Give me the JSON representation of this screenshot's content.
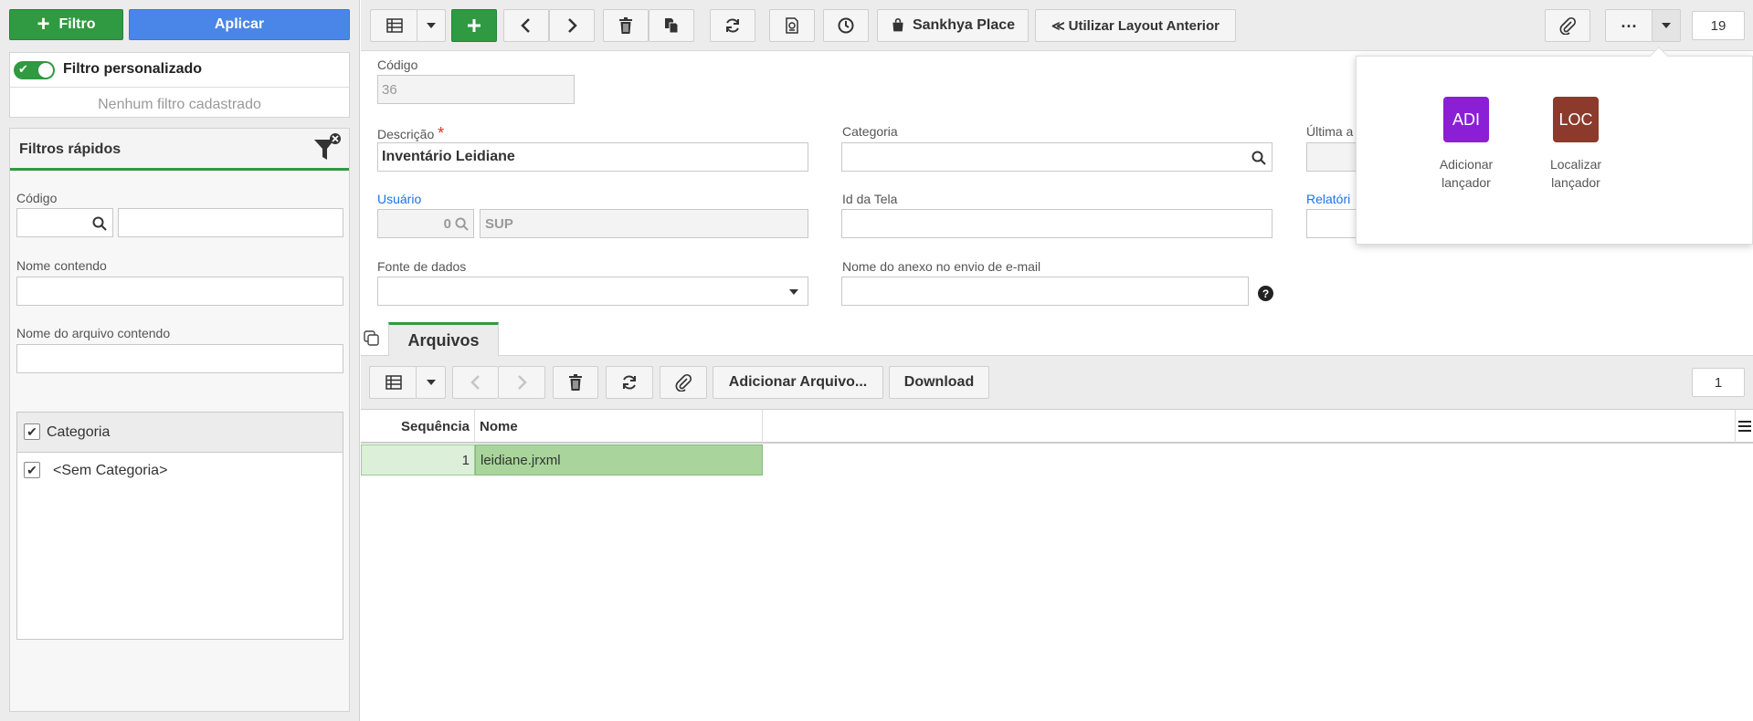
{
  "left": {
    "filter_button": "Filtro",
    "apply_button": "Aplicar",
    "custom_filter_label": "Filtro personalizado",
    "no_filter_text": "Nenhum filtro cadastrado",
    "quick_filters_title": "Filtros rápidos",
    "codigo_label": "Código",
    "nome_contendo_label": "Nome contendo",
    "arquivo_contendo_label": "Nome do arquivo contendo",
    "categoria_header": "Categoria",
    "categoria_item": "<Sem Categoria>"
  },
  "toolbar": {
    "sankhya_place": "Sankhya Place",
    "layout_anterior": "Utilizar Layout Anterior",
    "page_count": "19"
  },
  "form": {
    "codigo_label": "Código",
    "codigo_value": "36",
    "descricao_label": "Descrição",
    "descricao_value": "Inventário Leidiane",
    "categoria_label": "Categoria",
    "ultima_label": "Última a",
    "usuario_label": "Usuário",
    "usuario_code": "0",
    "usuario_name": "SUP",
    "id_tela_label": "Id da Tela",
    "relatorio_label": "Relatóri",
    "fonte_label": "Fonte de dados",
    "anexo_label": "Nome do anexo no envio de e-mail"
  },
  "popup": {
    "items": [
      {
        "abbr": "ADI",
        "line1": "Adicionar",
        "line2": "lançador",
        "color": "#8b1fd6"
      },
      {
        "abbr": "LOC",
        "line1": "Localizar",
        "line2": "lançador",
        "color": "#8b3a2b"
      }
    ]
  },
  "tabs": {
    "arquivos": "Arquivos"
  },
  "sub_toolbar": {
    "add_file": "Adicionar Arquivo...",
    "download": "Download",
    "count": "1"
  },
  "grid": {
    "columns": [
      "Sequência",
      "Nome"
    ],
    "rows": [
      {
        "seq": "1",
        "nome": "leidiane.jrxml"
      }
    ]
  }
}
